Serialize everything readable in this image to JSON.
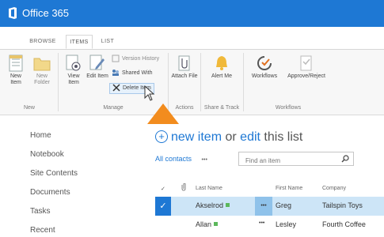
{
  "suite": {
    "title": "Office 365"
  },
  "tabs": [
    {
      "label": "BROWSE"
    },
    {
      "label": "ITEMS"
    },
    {
      "label": "LIST"
    }
  ],
  "ribbon": {
    "new_group": {
      "new_item_label": "New Item",
      "new_folder_label": "New Folder",
      "group_label": "New"
    },
    "manage_group": {
      "view_item_label": "View Item",
      "edit_item_label": "Edit Item",
      "version_history_label": "Version History",
      "shared_with_label": "Shared With",
      "delete_item_label": "Delete Item",
      "group_label": "Manage"
    },
    "actions_group": {
      "attach_file_label": "Attach File",
      "group_label": "Actions"
    },
    "share_group": {
      "alert_me_label": "Alert Me",
      "group_label": "Share & Track"
    },
    "workflows_group": {
      "workflows_label": "Workflows",
      "approve_label": "Approve/Reject",
      "group_label": "Workflows"
    }
  },
  "leftnav": {
    "items": [
      {
        "label": "Home"
      },
      {
        "label": "Notebook"
      },
      {
        "label": "Site Contents"
      },
      {
        "label": "Documents"
      },
      {
        "label": "Tasks"
      },
      {
        "label": "Recent"
      }
    ]
  },
  "content": {
    "new_item_text": "new item",
    "or_text": "or",
    "edit_text": "edit",
    "this_list_text": "this list",
    "view_label": "All contacts",
    "view_more": "•••",
    "search_placeholder": "Find an item",
    "columns": {
      "attach": "",
      "last_name": "Last Name",
      "first_name": "First Name",
      "company": "Company"
    },
    "rows": [
      {
        "last_name": "Akselrod",
        "first_name": "Greg",
        "company": "Tailspin Toys",
        "selected": true,
        "ellipsis": "•••"
      },
      {
        "last_name": "Allan",
        "first_name": "Lesley",
        "company": "Fourth Coffee",
        "selected": false,
        "ellipsis": "•••"
      }
    ]
  },
  "colors": {
    "brand": "#1e78d4",
    "annotation_arrow": "#f28c1e",
    "selected_row": "#cde5f7"
  }
}
